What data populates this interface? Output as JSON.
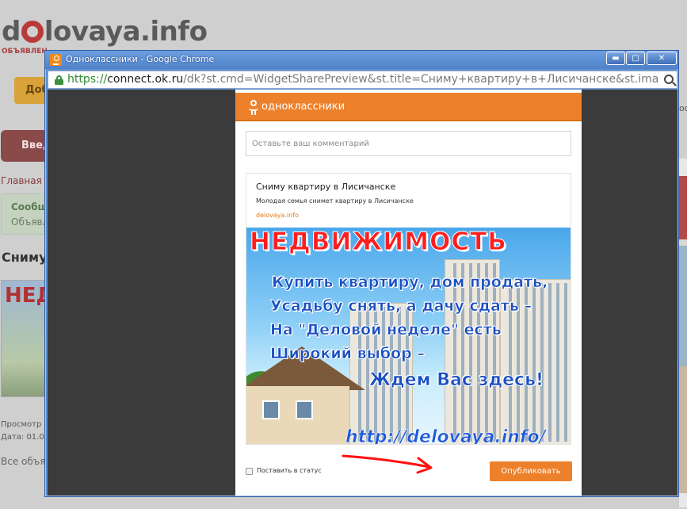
{
  "background_page": {
    "logo_pre": "d",
    "logo_post": "lovaya.info",
    "tagline": "ОБЪЯВЛЕН",
    "orange_button": "Доб",
    "red_button": "Введ",
    "breadcrumb": "Главная -",
    "message_title": "Сообщ",
    "message_text": "Объявл",
    "heading": "Сниму",
    "thumb_text": "НЕД",
    "views": "Просмотр",
    "date": "Дата: 01.0",
    "all_ads": "Все объя",
    "right_edge_text": "оо"
  },
  "window": {
    "title": "Одноклассники - Google Chrome",
    "min_glyph": "▬",
    "max_glyph": "▢",
    "close_glyph": "✕",
    "address": {
      "scheme": "https://",
      "host": "connect.ok.ru",
      "path": "/dk?st.cmd=WidgetSharePreview&st.title=Сниму+квартиру+в+Лисичанске&st.ima"
    }
  },
  "dialog": {
    "brand": "одноклассники",
    "comment_placeholder": "Оставьте ваш комментарий",
    "card": {
      "title": "Сниму квартиру в Лисичанске",
      "description": "Молодая семья снимет квартиру в Лисичанске",
      "site": "delovaya.info"
    },
    "banner": {
      "title": "НЕДВИЖИМОСТЬ",
      "lines": [
        "Купить квартиру, дом продать,",
        "Усадьбу снять, а дачу сдать –",
        "На \"Деловой неделе\" есть",
        "Широкий выбор –",
        "Ждем Вас здесь!"
      ],
      "url": "http://delovaya.info/"
    },
    "status_checkbox_label": "Поставить в статус",
    "status_checked": false,
    "publish_label": "Опубликовать",
    "accent_color": "#ed812b"
  }
}
